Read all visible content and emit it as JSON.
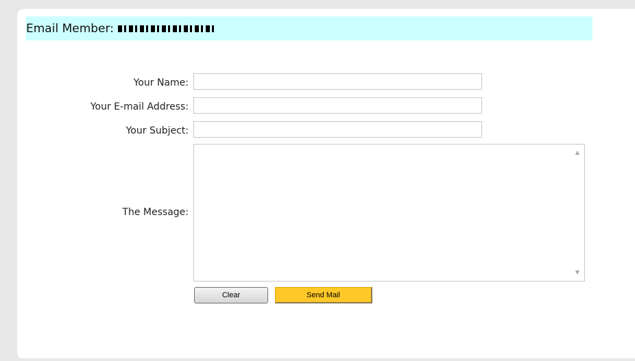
{
  "header": {
    "label": "Email Member:",
    "member_name": "Lucas, J. Paul"
  },
  "form": {
    "name_label": "Your Name:",
    "name_value": "",
    "email_label": "Your E-mail Address:",
    "email_value": "",
    "subject_label": "Your Subject:",
    "subject_value": "",
    "message_label": "The Message:",
    "message_value": ""
  },
  "buttons": {
    "clear_label": "Clear",
    "send_label": "Send Mail"
  },
  "icons": {
    "scroll_up": "scroll-up-arrow-icon",
    "scroll_down": "scroll-down-arrow-icon"
  },
  "colors": {
    "header_bg": "#ccffff",
    "send_button_bg": "#ffc828",
    "page_bg": "#e8e8e8"
  }
}
